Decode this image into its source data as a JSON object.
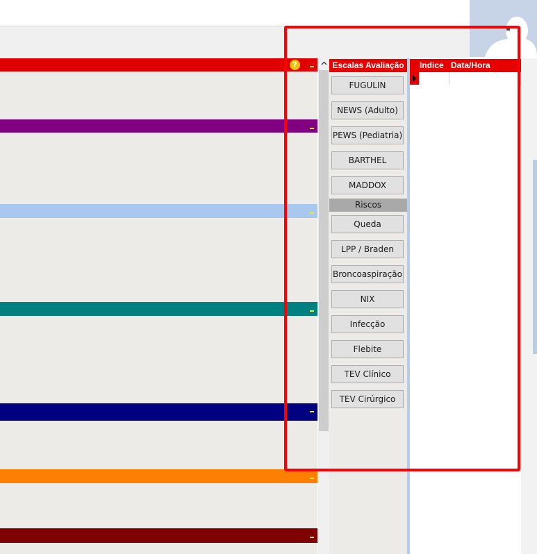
{
  "colors": {
    "accent_red": "#e60000",
    "panel_bg": "#ecebe8",
    "section_bars": [
      "#e00000",
      "#800080",
      "#a9c8ef",
      "#008080",
      "#000080",
      "#ff8000",
      "#800000"
    ],
    "highlight": "#ff0000"
  },
  "left_panel": {
    "help_icon": "?",
    "sections": [
      {
        "color": "#e00000",
        "help": true
      },
      {
        "color": "#800080"
      },
      {
        "color": "#a9c8ef"
      },
      {
        "color": "#008080"
      },
      {
        "color": "#000080"
      },
      {
        "color": "#ff8000"
      },
      {
        "color": "#800000"
      }
    ]
  },
  "escalas": {
    "title": "Escalas Avaliação",
    "buttons": [
      "FUGULIN",
      "NEWS (Adulto)",
      "PEWS (Pediatria)",
      "BARTHEL",
      "MADDOX"
    ],
    "riscos_title": "Riscos",
    "riscos_buttons": [
      "Queda",
      "LPP / Braden",
      "Broncoaspiração",
      "NIX",
      "Infecção",
      "Flebite",
      "TEV Clínico",
      "TEV Cirúrgico"
    ]
  },
  "grid": {
    "columns": [
      "Indice",
      "Data/Hora"
    ]
  },
  "icons": {
    "scroll_up": "scroll-up-icon",
    "help": "help-icon",
    "row_pointer": "row-pointer-icon",
    "avatar": "user-avatar-icon"
  }
}
